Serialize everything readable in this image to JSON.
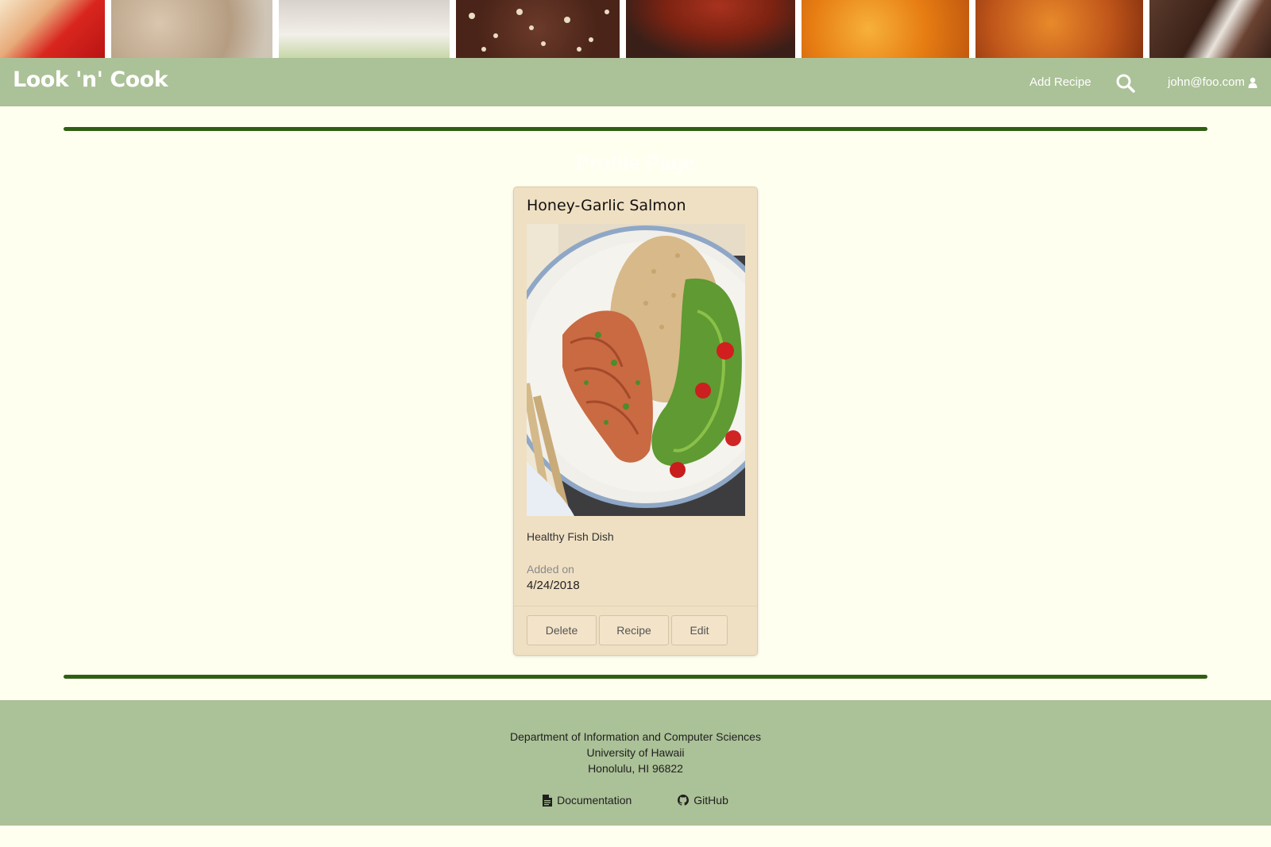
{
  "navbar": {
    "brand": "Look 'n' Cook",
    "add_recipe": "Add Recipe",
    "search_icon": "search-icon",
    "user_email": "john@foo.com",
    "user_icon": "user-icon"
  },
  "page": {
    "heading": "Profile Page"
  },
  "card": {
    "title": "Honey-Garlic Salmon",
    "description": "Healthy Fish Dish",
    "added_label": "Added on",
    "added_date": "4/24/2018",
    "buttons": {
      "delete": "Delete",
      "recipe": "Recipe",
      "edit": "Edit"
    }
  },
  "footer": {
    "line1": "Department of Information and Computer Sciences",
    "line2": "University of Hawaii",
    "line3": "Honolulu, HI 96822",
    "documentation": "Documentation",
    "github": "GitHub"
  },
  "colors": {
    "navbar": "#abc197",
    "background": "#fffff0",
    "divider": "#2f5f14",
    "card": "#f0e0c3"
  }
}
